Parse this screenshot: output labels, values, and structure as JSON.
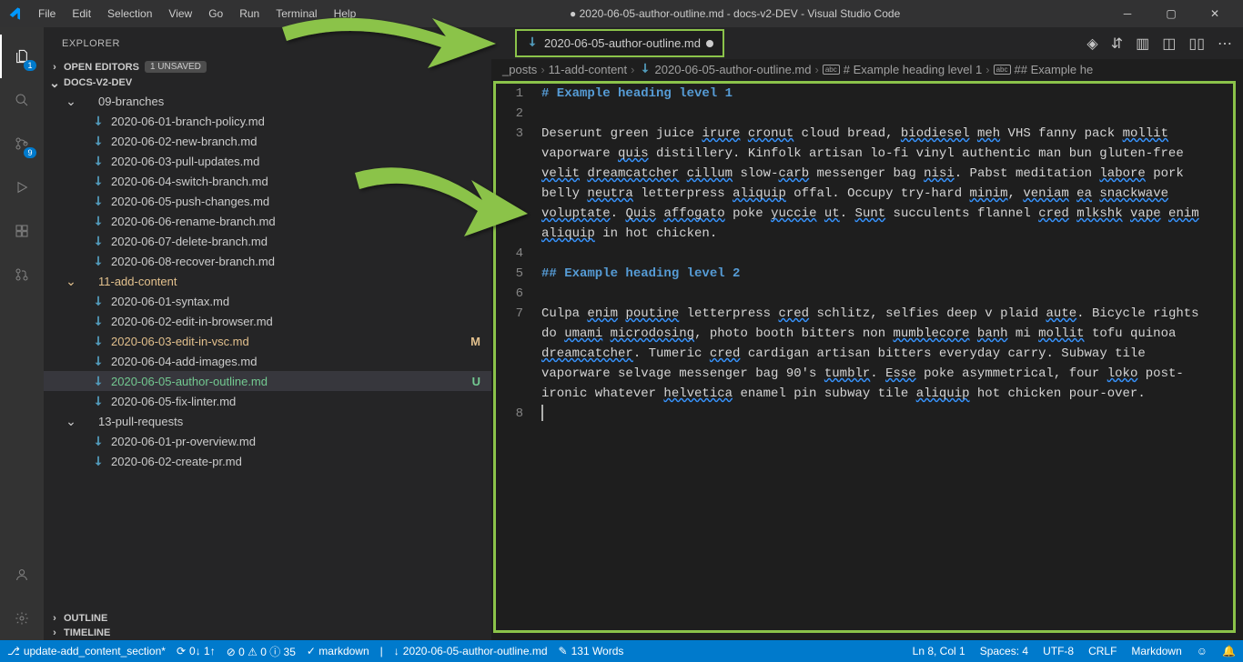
{
  "title": "● 2020-06-05-author-outline.md - docs-v2-DEV - Visual Studio Code",
  "menu": [
    "File",
    "Edit",
    "Selection",
    "View",
    "Go",
    "Run",
    "Terminal",
    "Help"
  ],
  "activity": {
    "explorer_badge": "1",
    "scm_badge": "9"
  },
  "sidebar": {
    "title": "EXPLORER",
    "open_editors_label": "OPEN EDITORS",
    "unsaved_badge": "1 UNSAVED",
    "root_label": "DOCS-V2-DEV",
    "outline_label": "OUTLINE",
    "timeline_label": "TIMELINE",
    "tree": [
      {
        "type": "folder-open",
        "label": "09-branches",
        "indent": 1
      },
      {
        "type": "file",
        "label": "2020-06-01-branch-policy.md",
        "indent": 2
      },
      {
        "type": "file",
        "label": "2020-06-02-new-branch.md",
        "indent": 2
      },
      {
        "type": "file",
        "label": "2020-06-03-pull-updates.md",
        "indent": 2
      },
      {
        "type": "file",
        "label": "2020-06-04-switch-branch.md",
        "indent": 2
      },
      {
        "type": "file",
        "label": "2020-06-05-push-changes.md",
        "indent": 2
      },
      {
        "type": "file",
        "label": "2020-06-06-rename-branch.md",
        "indent": 2
      },
      {
        "type": "file",
        "label": "2020-06-07-delete-branch.md",
        "indent": 2
      },
      {
        "type": "file",
        "label": "2020-06-08-recover-branch.md",
        "indent": 2
      },
      {
        "type": "folder-open",
        "label": "11-add-content",
        "indent": 1,
        "mod": true
      },
      {
        "type": "file",
        "label": "2020-06-01-syntax.md",
        "indent": 2
      },
      {
        "type": "file",
        "label": "2020-06-02-edit-in-browser.md",
        "indent": 2
      },
      {
        "type": "file",
        "label": "2020-06-03-edit-in-vsc.md",
        "indent": 2,
        "mod": true,
        "status": "M"
      },
      {
        "type": "file",
        "label": "2020-06-04-add-images.md",
        "indent": 2
      },
      {
        "type": "file",
        "label": "2020-06-05-author-outline.md",
        "indent": 2,
        "untracked": true,
        "status": "U",
        "active": true
      },
      {
        "type": "file",
        "label": "2020-06-05-fix-linter.md",
        "indent": 2
      },
      {
        "type": "folder-open",
        "label": "13-pull-requests",
        "indent": 1
      },
      {
        "type": "file",
        "label": "2020-06-01-pr-overview.md",
        "indent": 2
      },
      {
        "type": "file",
        "label": "2020-06-02-create-pr.md",
        "indent": 2
      }
    ]
  },
  "tab": {
    "label": "2020-06-05-author-outline.md"
  },
  "breadcrumbs": [
    {
      "label": "_posts"
    },
    {
      "label": "11-add-content"
    },
    {
      "label": "2020-06-05-author-outline.md",
      "file": true
    },
    {
      "label": "# Example heading level 1",
      "sym": "abc"
    },
    {
      "label": "## Example he",
      "sym": "abc"
    }
  ],
  "editor": {
    "lines": [
      {
        "n": 1,
        "h": 1,
        "text": "# Example heading level 1"
      },
      {
        "n": 2,
        "text": ""
      },
      {
        "n": 3,
        "wrap": true,
        "runs": [
          [
            "Deserunt green juice ",
            false
          ],
          [
            "irure",
            true
          ],
          [
            " ",
            false
          ],
          [
            "cronut",
            true
          ],
          [
            " cloud bread, ",
            false
          ],
          [
            "biodiesel",
            true
          ],
          [
            " ",
            false
          ],
          [
            "meh",
            true
          ],
          [
            " VHS fanny pack ",
            false
          ],
          [
            "mollit",
            true
          ],
          [
            " vaporware ",
            false
          ],
          [
            "quis",
            true
          ],
          [
            " distillery. Kinfolk artisan lo-fi vinyl authentic man bun gluten-free ",
            false
          ],
          [
            "velit",
            true
          ],
          [
            " ",
            false
          ],
          [
            "dreamcatcher",
            true
          ],
          [
            " ",
            false
          ],
          [
            "cillum",
            true
          ],
          [
            " slow-",
            false
          ],
          [
            "carb",
            true
          ],
          [
            " messenger bag ",
            false
          ],
          [
            "nisi",
            true
          ],
          [
            ". Pabst meditation ",
            false
          ],
          [
            "labore",
            true
          ],
          [
            " pork belly ",
            false
          ],
          [
            "neutra",
            true
          ],
          [
            " letterpress ",
            false
          ],
          [
            "aliquip",
            true
          ],
          [
            " offal. Occupy try-hard ",
            false
          ],
          [
            "minim",
            true
          ],
          [
            ", ",
            false
          ],
          [
            "veniam",
            true
          ],
          [
            " ",
            false
          ],
          [
            "ea",
            true
          ],
          [
            " ",
            false
          ],
          [
            "snackwave",
            true
          ],
          [
            " ",
            false
          ],
          [
            "voluptate",
            true
          ],
          [
            ". ",
            false
          ],
          [
            "Quis",
            true
          ],
          [
            " ",
            false
          ],
          [
            "affogato",
            true
          ],
          [
            " poke ",
            false
          ],
          [
            "yuccie",
            true
          ],
          [
            " ",
            false
          ],
          [
            "ut",
            true
          ],
          [
            ". ",
            false
          ],
          [
            "Sunt",
            true
          ],
          [
            " succulents flannel ",
            false
          ],
          [
            "cred",
            true
          ],
          [
            " ",
            false
          ],
          [
            "mlkshk",
            true
          ],
          [
            " ",
            false
          ],
          [
            "vape",
            true
          ],
          [
            " ",
            false
          ],
          [
            "enim",
            true
          ],
          [
            " ",
            false
          ],
          [
            "aliquip",
            true
          ],
          [
            " in hot chicken.",
            false
          ]
        ]
      },
      {
        "n": 4,
        "text": ""
      },
      {
        "n": 5,
        "h": 2,
        "text": "## Example heading level 2"
      },
      {
        "n": 6,
        "text": ""
      },
      {
        "n": 7,
        "wrap": true,
        "runs": [
          [
            "Culpa ",
            false
          ],
          [
            "enim",
            true
          ],
          [
            " ",
            false
          ],
          [
            "poutine",
            true
          ],
          [
            " letterpress ",
            false
          ],
          [
            "cred",
            true
          ],
          [
            " schlitz, selfies deep v plaid ",
            false
          ],
          [
            "aute",
            true
          ],
          [
            ". Bicycle rights do ",
            false
          ],
          [
            "umami",
            true
          ],
          [
            " ",
            false
          ],
          [
            "microdosing",
            true
          ],
          [
            ", photo booth bitters non ",
            false
          ],
          [
            "mumblecore",
            true
          ],
          [
            " ",
            false
          ],
          [
            "banh",
            true
          ],
          [
            " mi ",
            false
          ],
          [
            "mollit",
            true
          ],
          [
            " tofu quinoa ",
            false
          ],
          [
            "dreamcatcher",
            true
          ],
          [
            ". Tumeric ",
            false
          ],
          [
            "cred",
            true
          ],
          [
            " cardigan artisan bitters everyday carry. Subway tile vaporware selvage messenger bag 90's ",
            false
          ],
          [
            "tumblr",
            true
          ],
          [
            ". ",
            false
          ],
          [
            "Esse",
            true
          ],
          [
            " poke asymmetrical, four ",
            false
          ],
          [
            "loko",
            true
          ],
          [
            " post-ironic whatever ",
            false
          ],
          [
            "helvetica",
            true
          ],
          [
            " enamel pin subway tile ",
            false
          ],
          [
            "aliquip",
            true
          ],
          [
            " hot chicken pour-over.",
            false
          ]
        ]
      },
      {
        "n": 8,
        "text": "",
        "cursor": true
      }
    ]
  },
  "status": {
    "branch": "update-add_content_section*",
    "sync": "0↓ 1↑",
    "problems": "⊘ 0 ⚠ 0 ⓘ 35",
    "lint": "✓ markdown",
    "file": "2020-06-05-author-outline.md",
    "words": "131 Words",
    "cursor": "Ln 8, Col 1",
    "spaces": "Spaces: 4",
    "encoding": "UTF-8",
    "eol": "CRLF",
    "lang": "Markdown",
    "feedback": "☺",
    "bell": "🔔"
  }
}
